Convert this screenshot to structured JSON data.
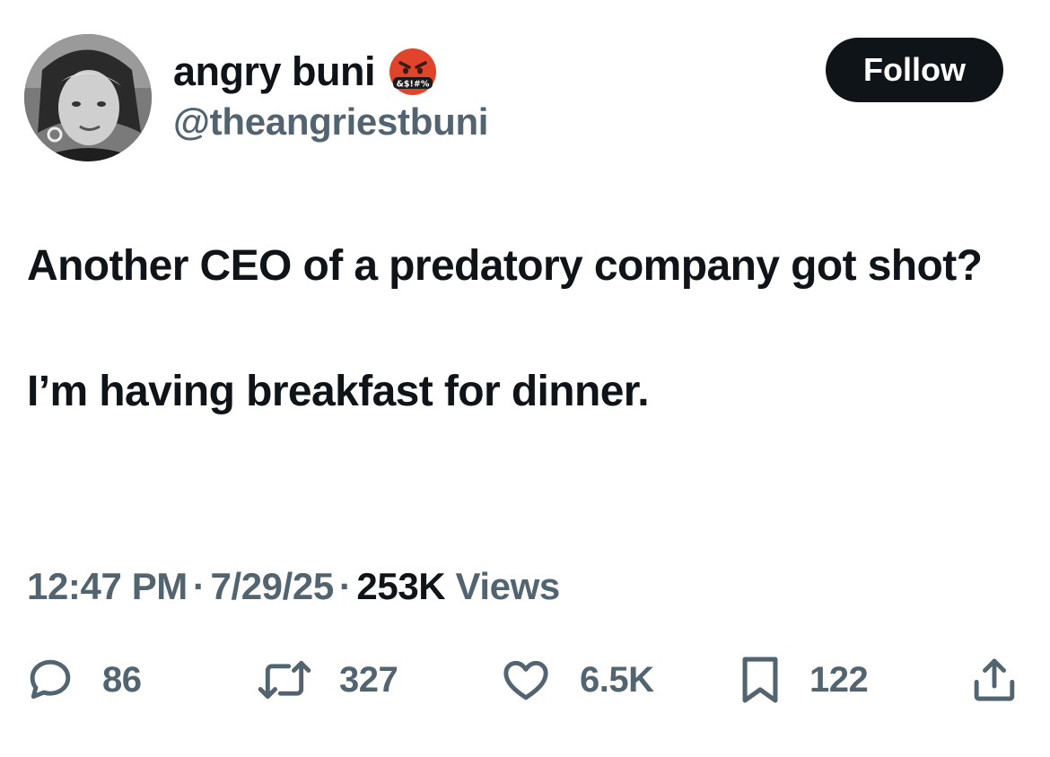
{
  "user": {
    "display_name": "angry buni",
    "name_emoji": "enraged-face-with-symbols-on-mouth",
    "handle": "@theangriestbuni"
  },
  "follow_label": "Follow",
  "tweet": {
    "line1": "Another CEO of a predatory company got shot?",
    "line2": "I’m having breakfast for dinner."
  },
  "meta": {
    "time": "12:47 PM",
    "date": "7/29/25",
    "separator": "·",
    "views_count": "253K",
    "views_label": "Views"
  },
  "actions": {
    "replies": "86",
    "reposts": "327",
    "likes": "6.5K",
    "bookmarks": "122"
  },
  "colors": {
    "text_primary": "#0f1419",
    "text_secondary": "#536471",
    "follow_bg": "#0f1419",
    "emoji_red": "#e0452b"
  }
}
